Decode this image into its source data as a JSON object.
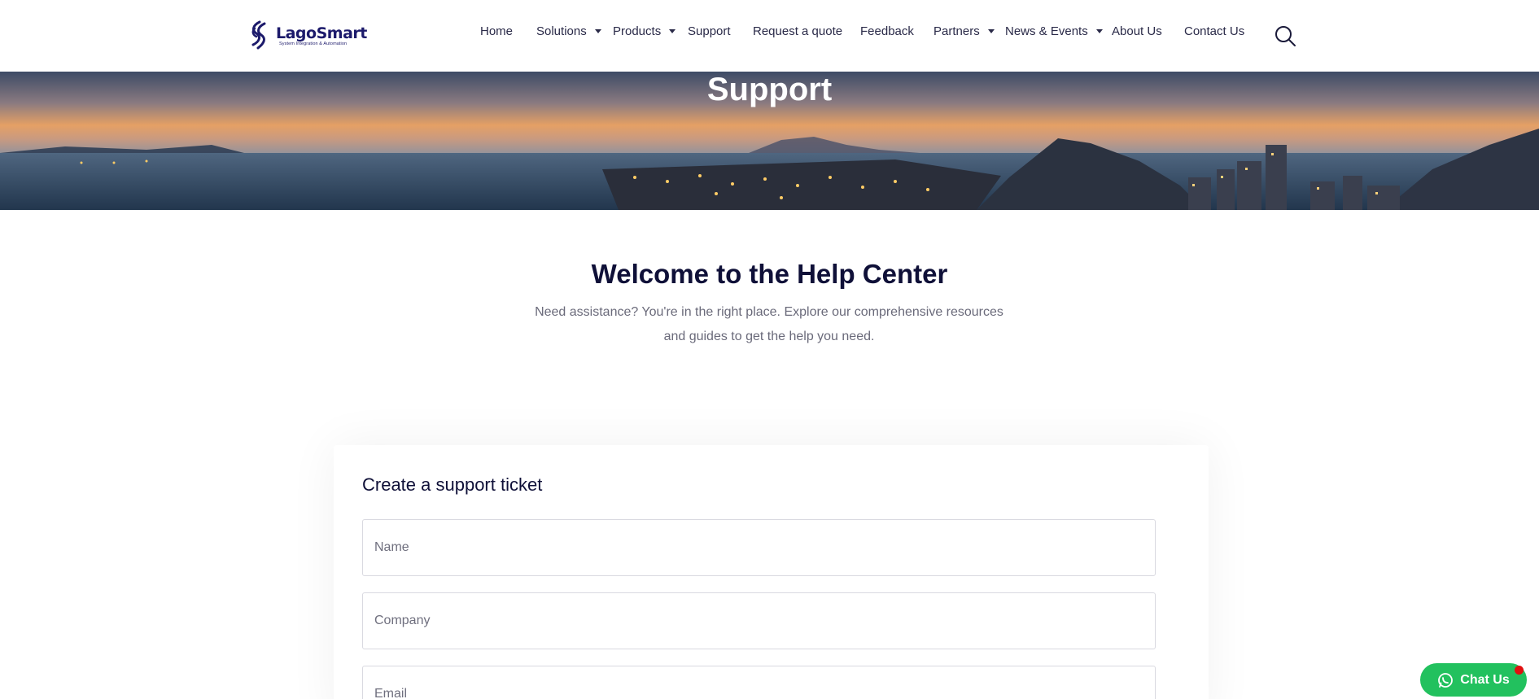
{
  "header": {
    "logo_name": "LagoSmart",
    "logo_tagline": "System Integration & Automation",
    "nav": [
      {
        "label": "Home",
        "has_dropdown": false
      },
      {
        "label": "Solutions",
        "has_dropdown": true
      },
      {
        "label": "Products",
        "has_dropdown": true
      },
      {
        "label": "Support",
        "has_dropdown": false
      },
      {
        "label": "Request a quote",
        "has_dropdown": false
      },
      {
        "label": "Feedback",
        "has_dropdown": false
      },
      {
        "label": "Partners",
        "has_dropdown": true
      },
      {
        "label": "News & Events",
        "has_dropdown": true
      },
      {
        "label": "About Us",
        "has_dropdown": false
      },
      {
        "label": "Contact Us",
        "has_dropdown": false
      }
    ],
    "search_icon": "search-icon"
  },
  "banner": {
    "title": "Support"
  },
  "intro": {
    "heading": "Welcome to the Help Center",
    "text": "Need assistance? You're in the right place. Explore our comprehensive resources and guides to get the help you need."
  },
  "ticket_form": {
    "title": "Create a support ticket",
    "name_placeholder": "Name",
    "company_placeholder": "Company",
    "email_placeholder": "Email"
  },
  "chat": {
    "label": "Chat Us",
    "icon": "whatsapp-icon"
  },
  "colors": {
    "brand": "#1c1a6b",
    "chat": "#22c15e",
    "heading": "#0f1038"
  }
}
